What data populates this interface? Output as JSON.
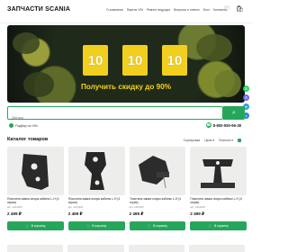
{
  "header": {
    "logo": "ЗАПЧАСТИ SCANIA",
    "nav": [
      "О компании",
      "Пакеты VIN",
      "Ремонт ведущих",
      "Вопросы и ответы",
      "Блог",
      "Контакты"
    ],
    "icons": [
      "heart-icon",
      "cart-icon"
    ]
  },
  "banner": {
    "tiles": [
      "10",
      "10",
      "10"
    ],
    "promo": "Получить скидку до 90%"
  },
  "search": {
    "placeholder": "Деталь",
    "button_icon": "search-icon"
  },
  "sub": {
    "vin_link": "Подбор по VIN",
    "phone": "8-800-550-96-38"
  },
  "side_icons": [
    "whatsapp-icon",
    "viber-icon",
    "telegram-icon",
    "vk-icon"
  ],
  "catalog": {
    "title": "Каталог товаров",
    "sort_label": "Сортировка",
    "filter_price": "Цена",
    "filter_sort": "Полнота"
  },
  "products": [
    {
      "name": "Пластина замка опоры кабины L-H (4 серия)",
      "art": "арт. 1414325",
      "price": "2 499 ₽",
      "buy": "В корзину"
    },
    {
      "name": "Пластина замка опоры кабины L-H (4 серия)",
      "art": "арт. 1414326",
      "price": "2 499 ₽",
      "buy": "В корзину"
    },
    {
      "name": "Пластина замка опоры кабины L-H (4 серия)",
      "art": "арт. 1414327",
      "price": "2 499 ₽",
      "buy": "В корзину"
    },
    {
      "name": "Пластина замка опоры кабины L-H (4 серия)",
      "art": "арт. 1414328",
      "price": "2 499 ₽",
      "buy": "В корзину"
    }
  ],
  "colors": {
    "accent": "#26a65b",
    "tile": "#f2cf1d",
    "promo": "#f4d316"
  }
}
